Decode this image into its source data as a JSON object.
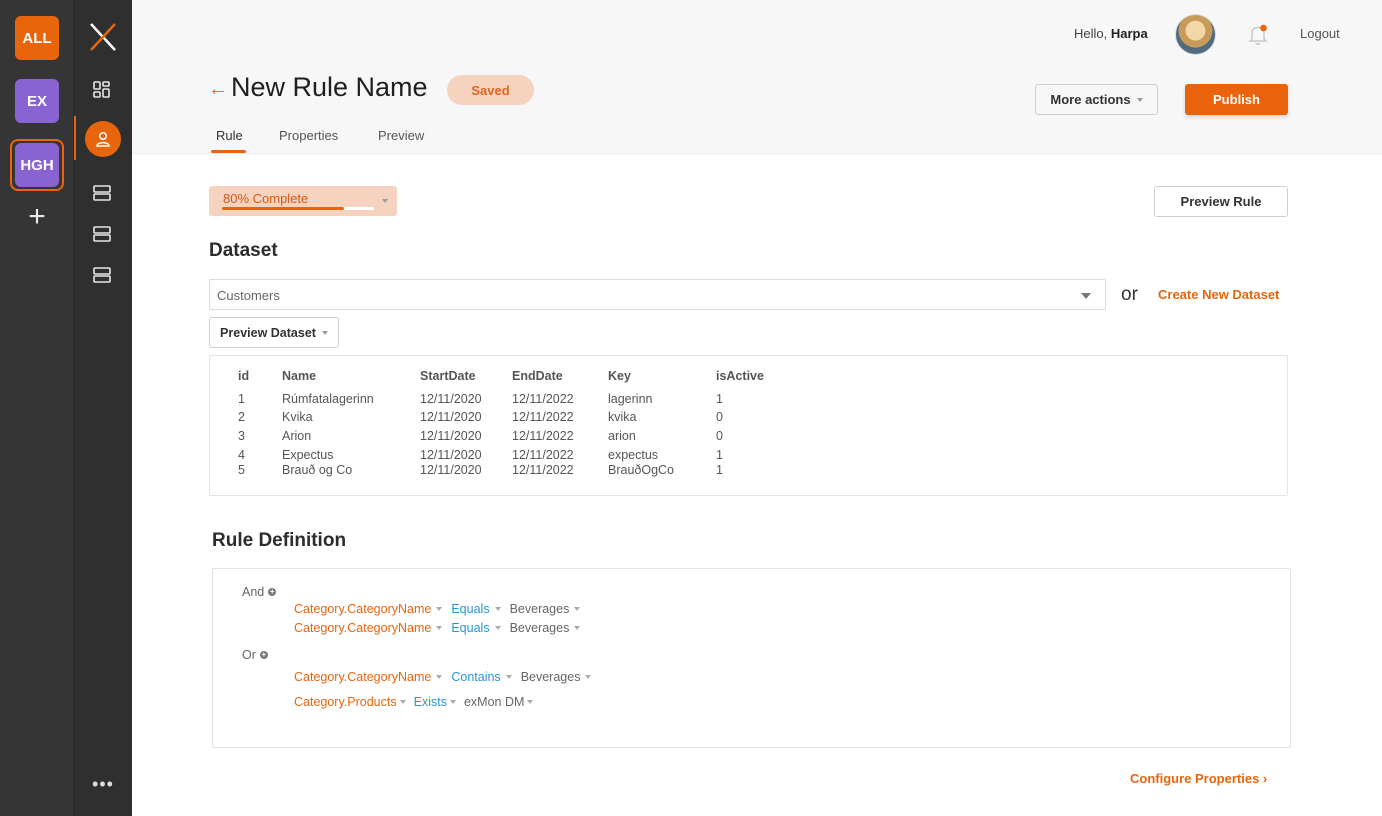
{
  "workspaces": [
    {
      "label": "ALL",
      "color": "#e8650c"
    },
    {
      "label": "EX",
      "color": "#8a63d2"
    },
    {
      "label": "HGH",
      "color": "#8a63d2",
      "selected": true
    }
  ],
  "nav_icons": [
    "dashboard-icon",
    "user-icon",
    "list-icon",
    "list-icon",
    "list-icon"
  ],
  "header": {
    "greeting_prefix": "Hello,",
    "user_name": "Harpa",
    "logout": "Logout",
    "title": "New Rule Name",
    "status_badge": "Saved",
    "more_actions": "More actions",
    "publish": "Publish"
  },
  "tabs": [
    {
      "label": "Rule",
      "active": true
    },
    {
      "label": "Properties",
      "active": false
    },
    {
      "label": "Preview",
      "active": false
    }
  ],
  "progress": {
    "label": "80% Complete",
    "percent": 80
  },
  "preview_rule": "Preview Rule",
  "dataset": {
    "heading": "Dataset",
    "selected": "Customers",
    "or": "or",
    "create_link": "Create New Dataset",
    "preview_button": "Preview Dataset",
    "columns": [
      "id",
      "Name",
      "StartDate",
      "EndDate",
      "Key",
      "isActive"
    ],
    "rows": [
      [
        "1",
        "Rúmfatalagerinn",
        "12/11/2020",
        "12/11/2022",
        "lagerinn",
        "1"
      ],
      [
        "2",
        "Kvika",
        "12/11/2020",
        "12/11/2022",
        "kvika",
        "0"
      ],
      [
        "3",
        "Arion",
        "12/11/2020",
        "12/11/2022",
        "arion",
        "0"
      ],
      [
        "4",
        "Expectus",
        "12/11/2020",
        "12/11/2022",
        "expectus",
        "1"
      ],
      [
        "5",
        "Brauð og Co",
        "12/11/2020",
        "12/11/2022",
        "BrauðOgCo",
        "1"
      ]
    ]
  },
  "rule": {
    "heading": "Rule Definition",
    "groups": [
      {
        "operator": "And",
        "conditions": [
          {
            "field": "Category.CategoryName",
            "op": "Equals",
            "value": "Beverages"
          },
          {
            "field": "Category.CategoryName",
            "op": "Equals",
            "value": "Beverages"
          }
        ]
      },
      {
        "operator": "Or",
        "conditions": [
          {
            "field": "Category.CategoryName",
            "op": "Contains",
            "value": "Beverages"
          },
          {
            "field": "Category.Products",
            "op": "Exists",
            "value": "exMon DM"
          }
        ]
      }
    ]
  },
  "configure_link": "Configure Properties ›",
  "colors": {
    "accent": "#e8650c",
    "operator": "#2a95d6",
    "workspace_purple": "#8a63d2"
  }
}
